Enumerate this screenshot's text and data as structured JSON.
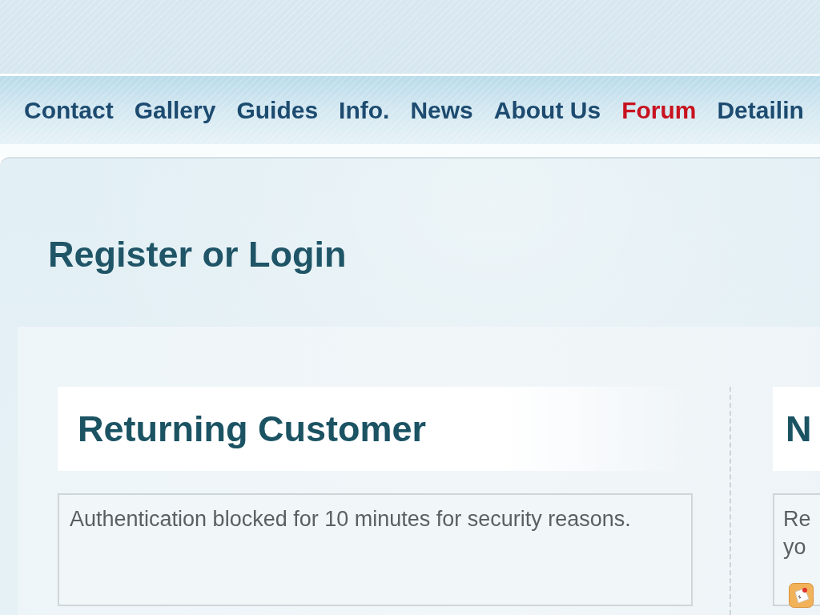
{
  "nav": {
    "items": [
      {
        "label": "Contact",
        "selected": false
      },
      {
        "label": "Gallery",
        "selected": false
      },
      {
        "label": "Guides",
        "selected": false
      },
      {
        "label": "Info.",
        "selected": false
      },
      {
        "label": "News",
        "selected": false
      },
      {
        "label": "About Us",
        "selected": false
      },
      {
        "label": "Forum",
        "selected": true
      },
      {
        "label": "Detailin",
        "selected": false
      }
    ]
  },
  "page_title": "Register or Login",
  "columns": [
    {
      "heading": "Returning Customer",
      "message_lines": [
        "Authentication blocked for 10 minutes for security reasons."
      ]
    },
    {
      "heading": "N",
      "message_lines": [
        "Re",
        "yo"
      ]
    }
  ]
}
